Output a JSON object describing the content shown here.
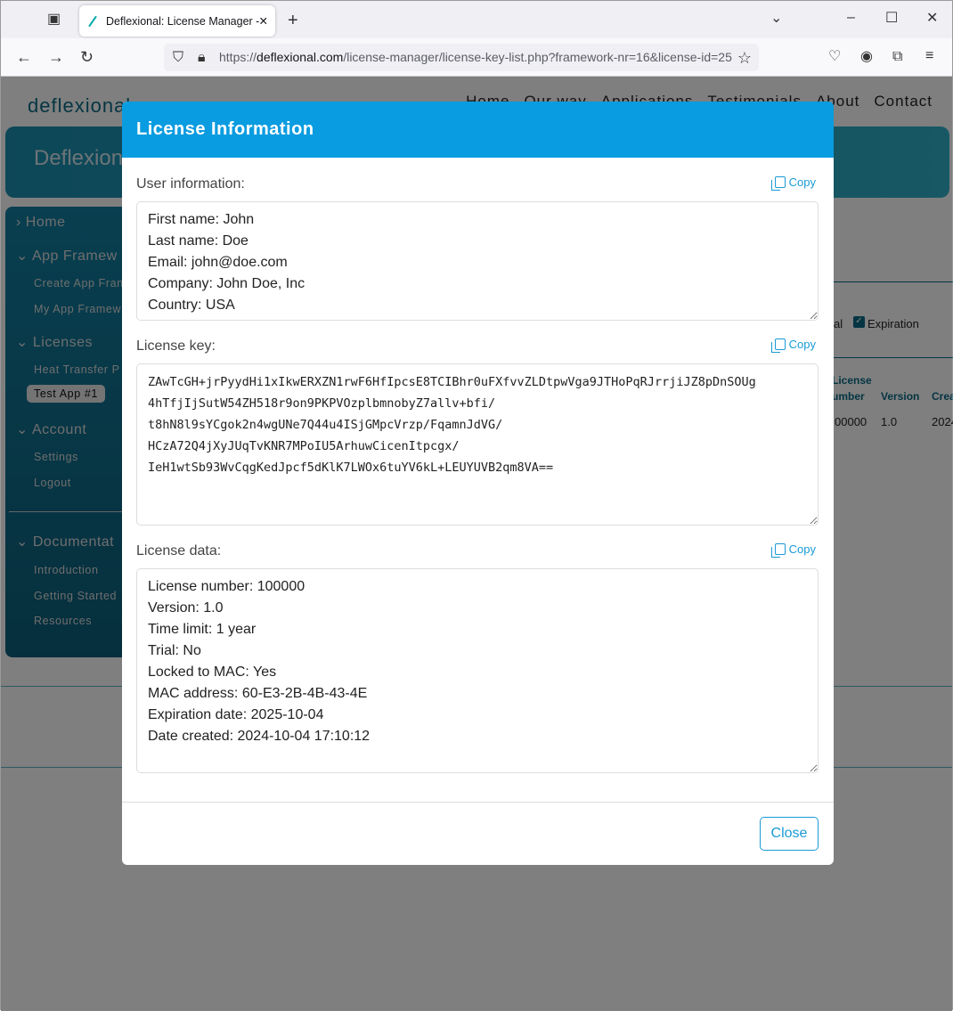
{
  "browser": {
    "tab_title": "Deflexional: License Manager - (",
    "url_prefix": "https://",
    "url_domain": "deflexional.com",
    "url_path": "/license-manager/license-key-list.php?framework-nr=16&license-id=25"
  },
  "site": {
    "logo": "deflexional",
    "nav": [
      "Home",
      "Our way",
      "Applications",
      "Testimonials",
      "About",
      "Contact"
    ],
    "banner": "Deflexional"
  },
  "sidebar": {
    "home": "Home",
    "app_frameworks": "App Framew",
    "create": "Create App Fran",
    "my": "My App Framew",
    "licenses": "Licenses",
    "heat": "Heat Transfer P",
    "test": "Test App #1",
    "account": "Account",
    "settings": "Settings",
    "logout": "Logout",
    "documentation": "Documentat",
    "intro": "Introduction",
    "getting": "Getting Started",
    "resources": "Resources"
  },
  "background_table": {
    "trial_label": "al",
    "expiration_label": "Expiration",
    "col1a": "License",
    "col1b": "umber",
    "col2": "Version",
    "col3": "Crea",
    "row": [
      "00000",
      "1.0",
      "2024"
    ]
  },
  "modal": {
    "title": "License Information",
    "copy_label": "Copy",
    "user_label": "User information:",
    "user_info": "First name: John\nLast name: Doe\nEmail: john@doe.com\nCompany: John Doe, Inc\nCountry: USA",
    "key_label": "License key:",
    "license_key": "ZAwTcGH+jrPyydHi1xIkwERXZN1rwF6HfIpcsE8TCIBhr0uFXfvvZLDtpwVga9JTHoPqRJrrjiJZ8pDnSOUg\n4hTfjIjSutW54ZH518r9on9PKPVOzplbmnobyZ7allv+bfi/\nt8hN8l9sYCgok2n4wgUNe7Q44u4ISjGMpcVrzp/FqamnJdVG/\nHCzA72Q4jXyJUqTvKNR7MPoIU5ArhuwCicenItpcgx/\nIeH1wtSb93WvCqgKedJpcf5dKlK7LWOx6tuYV6kL+LEUYUVB2qm8VA==",
    "data_label": "License data:",
    "license_data": "License number: 100000\nVersion: 1.0\nTime limit: 1 year\nTrial: No\nLocked to MAC: Yes\nMAC address: 60-E3-2B-4B-43-4E\nExpiration date: 2025-10-04\nDate created: 2024-10-04 17:10:12",
    "close_label": "Close"
  },
  "colors": {
    "accent": "#099ce0"
  }
}
